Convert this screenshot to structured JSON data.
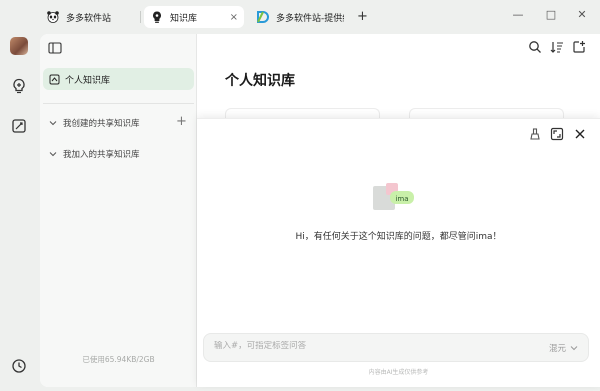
{
  "tabs": [
    {
      "title": "多多软件站",
      "icon": "panda-icon",
      "active": false
    },
    {
      "title": "知识库",
      "icon": "ima-bulb-icon",
      "active": true,
      "close": "×"
    },
    {
      "title": "多多软件站-提供综",
      "icon": "d-logo-icon",
      "active": false
    }
  ],
  "new_tab": "+",
  "window_controls": {
    "minimize": "—",
    "maximize": "□",
    "close": "✕"
  },
  "sidebar": {
    "active_item": "个人知识库",
    "sections": [
      {
        "label": "我创建的共享知识库",
        "add": "+"
      },
      {
        "label": "我加入的共享知识库"
      }
    ],
    "storage": "已使用65.94KB/2GB"
  },
  "main": {
    "title": "个人知识库"
  },
  "chat": {
    "logo_text": "ima",
    "greeting": "Hi，有任何关于这个知识库的问题，都尽管问ima！",
    "input_placeholder": "输入#，可指定标签问答",
    "model": "混元",
    "disclaimer": "内容由AI生成仅供参考"
  },
  "colors": {
    "accent_green": "#3bb36b",
    "active_bg": "#e1efe4",
    "app_bg": "#eef0ee"
  }
}
